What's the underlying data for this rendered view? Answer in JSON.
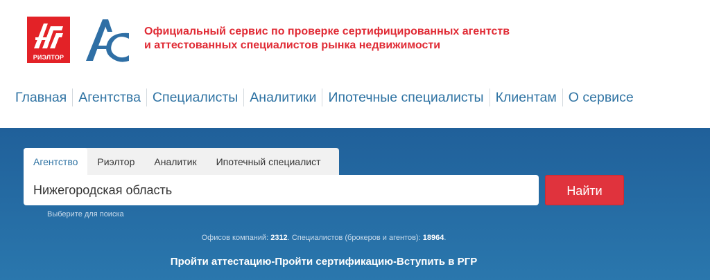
{
  "brand": {
    "rieltor_logo_text": "РИЭЛТОР",
    "tagline_line1": "Официальный сервис по проверке сертифицированных агентств",
    "tagline_line2": "и аттестованных специалистов рынка недвижимости"
  },
  "nav": {
    "items": [
      {
        "label": "Главная"
      },
      {
        "label": "Агентства"
      },
      {
        "label": "Специалисты"
      },
      {
        "label": "Аналитики"
      },
      {
        "label": "Ипотечные специалисты"
      },
      {
        "label": "Клиентам"
      },
      {
        "label": "О сервисе"
      }
    ]
  },
  "search": {
    "tabs": [
      {
        "label": "Агентство",
        "active": true
      },
      {
        "label": "Риэлтор",
        "active": false
      },
      {
        "label": "Аналитик",
        "active": false
      },
      {
        "label": "Ипотечный специалист",
        "active": false
      }
    ],
    "input_value": "Нижегородская область",
    "button_label": "Найти",
    "hint": "Выберите для поиска"
  },
  "stats": {
    "offices_label": "Офисов компаний:",
    "offices_count": "2312",
    "specialists_label": "Специалистов (брокеров и агентов):",
    "specialists_count": "18964"
  },
  "cta": {
    "label": "Пройти аттестацию-Пройти сертификацию-Вступить в РГР"
  },
  "colors": {
    "brand_red": "#e32227",
    "nav_blue": "#2f73a3",
    "band_blue": "#20609a",
    "button_red": "#e0333d"
  }
}
